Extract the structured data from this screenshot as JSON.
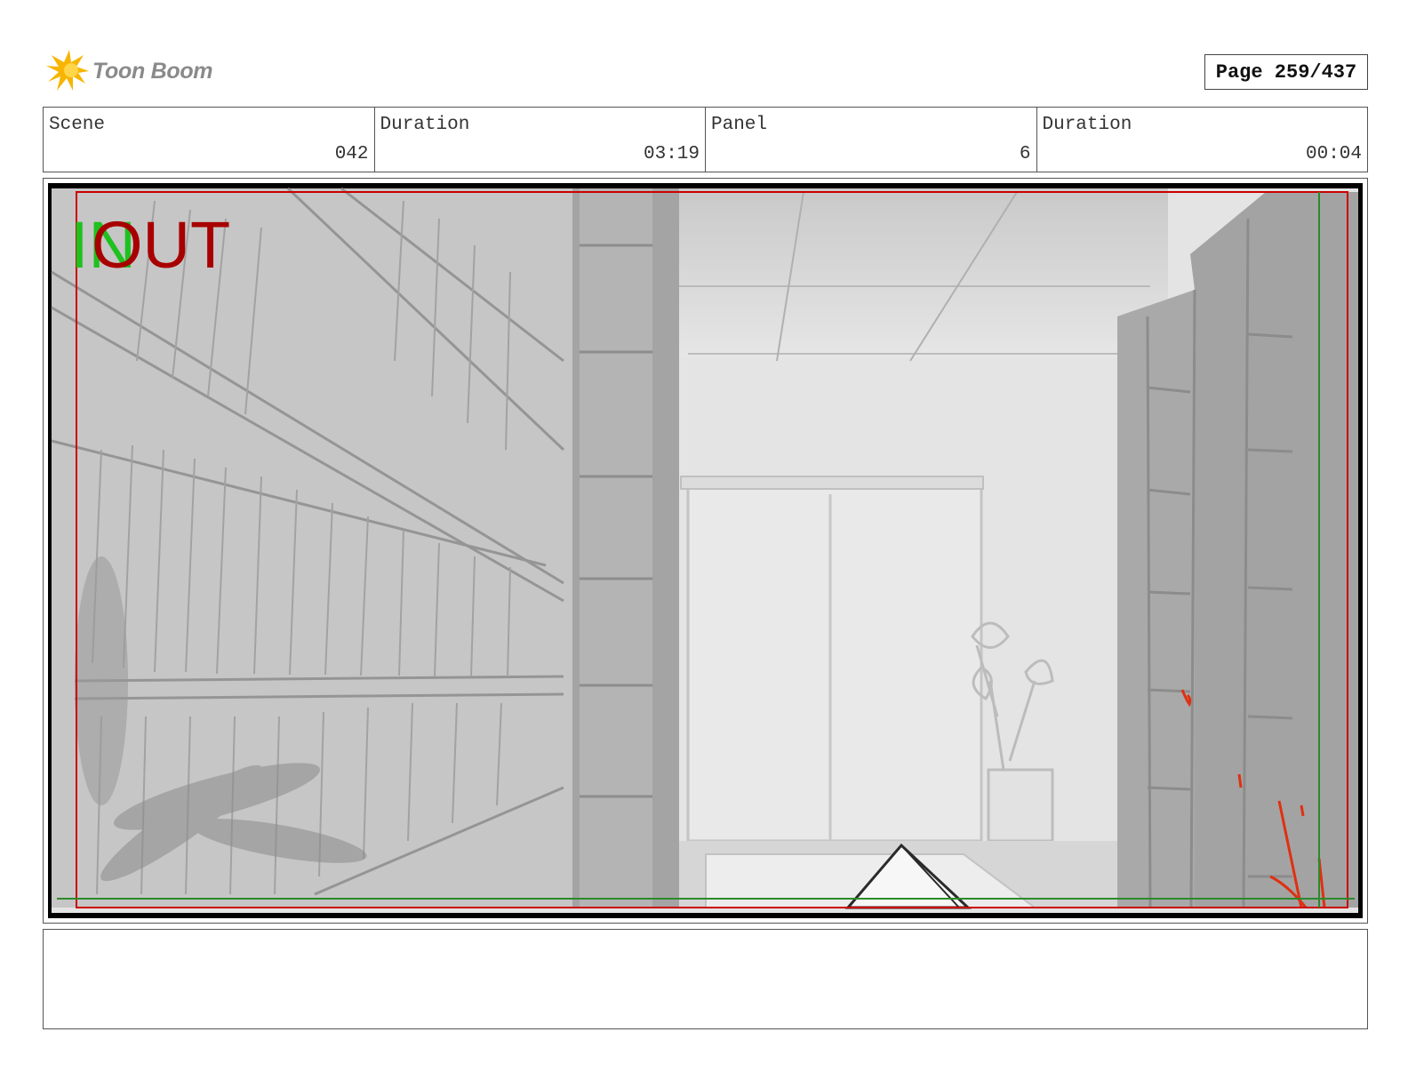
{
  "logo": {
    "text": "Toon Boom",
    "icon": "toon-boom-burst-icon",
    "color": "#f5b400"
  },
  "page": {
    "label": "Page 259/437"
  },
  "info": {
    "scene_label": "Scene",
    "scene_value": "042",
    "scene_duration_label": "Duration",
    "scene_duration_value": "03:19",
    "panel_label": "Panel",
    "panel_value": "6",
    "panel_duration_label": "Duration",
    "panel_duration_value": "00:04"
  },
  "panel": {
    "in_text": "IN",
    "out_text": "OUT",
    "in_color": "#1fc11f",
    "out_color": "#a80000",
    "safe_frame_color": "#cc0000"
  },
  "notes": {
    "text": ""
  }
}
